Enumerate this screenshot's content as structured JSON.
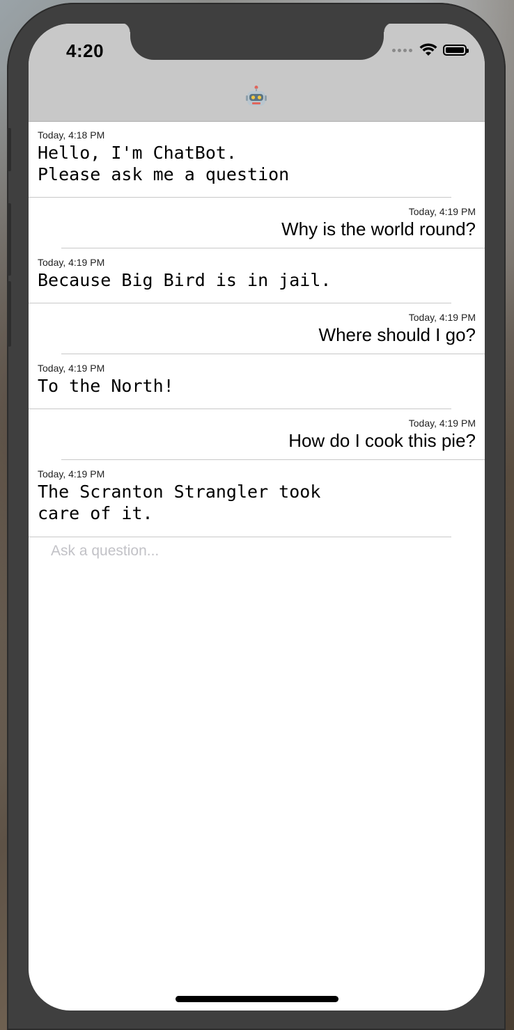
{
  "status_bar": {
    "time": "4:20"
  },
  "header": {
    "icon": "robot-icon"
  },
  "messages": [
    {
      "sender": "bot",
      "timestamp": "Today, 4:18 PM",
      "text": "Hello, I'm ChatBot.\nPlease ask me a question"
    },
    {
      "sender": "user",
      "timestamp": "Today, 4:19 PM",
      "text": "Why is the world round?"
    },
    {
      "sender": "bot",
      "timestamp": "Today, 4:19 PM",
      "text": "Because Big Bird is in jail."
    },
    {
      "sender": "user",
      "timestamp": "Today, 4:19 PM",
      "text": "Where should I go?"
    },
    {
      "sender": "bot",
      "timestamp": "Today, 4:19 PM",
      "text": "To the North!"
    },
    {
      "sender": "user",
      "timestamp": "Today, 4:19 PM",
      "text": "How do I cook this pie?"
    },
    {
      "sender": "bot",
      "timestamp": "Today, 4:19 PM",
      "text": "The Scranton Strangler took\ncare of it."
    }
  ],
  "input": {
    "placeholder": "Ask a question...",
    "value": ""
  }
}
